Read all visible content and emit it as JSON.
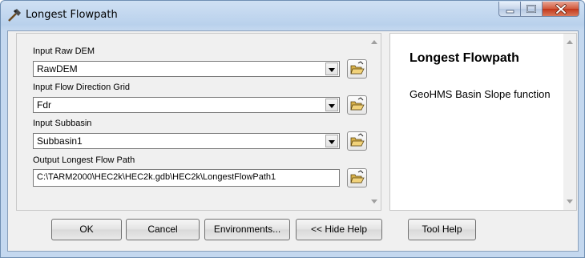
{
  "window": {
    "title": "Longest Flowpath"
  },
  "form": {
    "raw_dem_label": "Input Raw DEM",
    "raw_dem_value": "RawDEM",
    "flow_dir_label": "Input Flow Direction Grid",
    "flow_dir_value": "Fdr",
    "subbasin_label": "Input Subbasin",
    "subbasin_value": "Subbasin1",
    "output_label": "Output Longest Flow Path",
    "output_value": "C:\\TARM2000\\HEC2k\\HEC2k.gdb\\HEC2k\\LongestFlowPath1"
  },
  "help": {
    "title": "Longest Flowpath",
    "body": "GeoHMS Basin Slope function"
  },
  "buttons": {
    "ok": "OK",
    "cancel": "Cancel",
    "environments": "Environments...",
    "hide_help": "<< Hide Help",
    "tool_help": "Tool Help"
  },
  "icons": {
    "title": "hammer-icon",
    "browse": "open-folder-icon",
    "dropdown": "chevron-down-icon",
    "minimize": "minimize-icon",
    "maximize": "maximize-icon",
    "close": "close-icon"
  }
}
